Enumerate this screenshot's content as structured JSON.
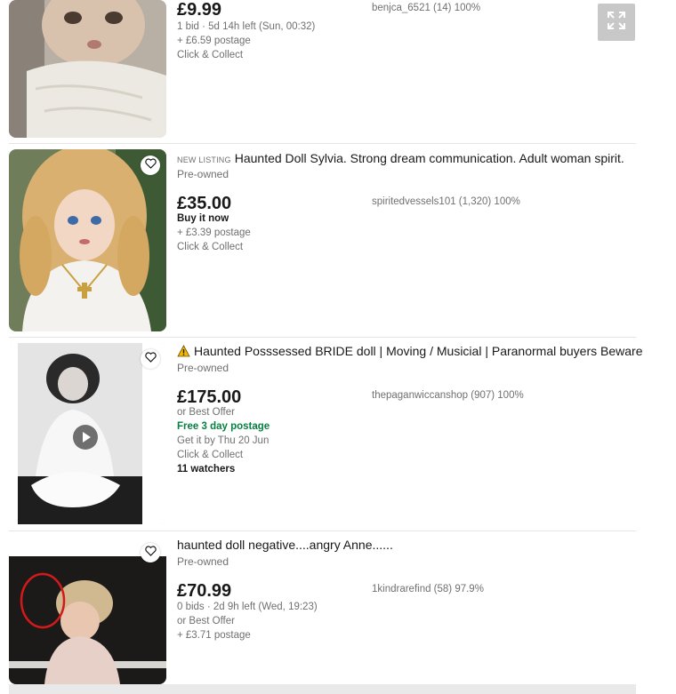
{
  "listings": [
    {
      "price": "£9.99",
      "bids_time": "1 bid · 5d 14h left (Sun, 00:32)",
      "postage": "+ £6.59 postage",
      "collect": "Click & Collect",
      "seller": "benjca_6521 (14) 100%"
    },
    {
      "badge": "NEW LISTING",
      "title": "Haunted Doll Sylvia. Strong dream communication. Adult woman spirit.",
      "condition": "Pre-owned",
      "price": "£35.00",
      "buy_format": "Buy it now",
      "postage": "+ £3.39 postage",
      "collect": "Click & Collect",
      "seller": "spiritedvessels101 (1,320) 100%"
    },
    {
      "title": "Haunted Posssessed BRIDE doll | Moving / Musicial | Paranormal buyers Beware",
      "condition": "Pre-owned",
      "price": "£175.00",
      "offer": "or Best Offer",
      "postage": "Free 3 day postage",
      "delivery": "Get it by Thu 20 Jun",
      "collect": "Click & Collect",
      "watchers": "11 watchers",
      "seller": "thepaganwiccanshop (907) 100%"
    },
    {
      "title": "haunted doll negative....angry Anne......",
      "condition": "Pre-owned",
      "price": "£70.99",
      "bids_time": "0 bids · 2d 9h left (Wed, 19:23)",
      "offer": "or Best Offer",
      "postage": "+ £3.71 postage",
      "seller": "1kindrarefind (58) 97.9%"
    }
  ],
  "colors": {
    "text": "#191919",
    "muted": "#707070",
    "green": "#05823f",
    "warning": "#f5b800"
  },
  "icons": [
    "heart-icon",
    "expand-icon",
    "warning-icon",
    "play-icon"
  ]
}
